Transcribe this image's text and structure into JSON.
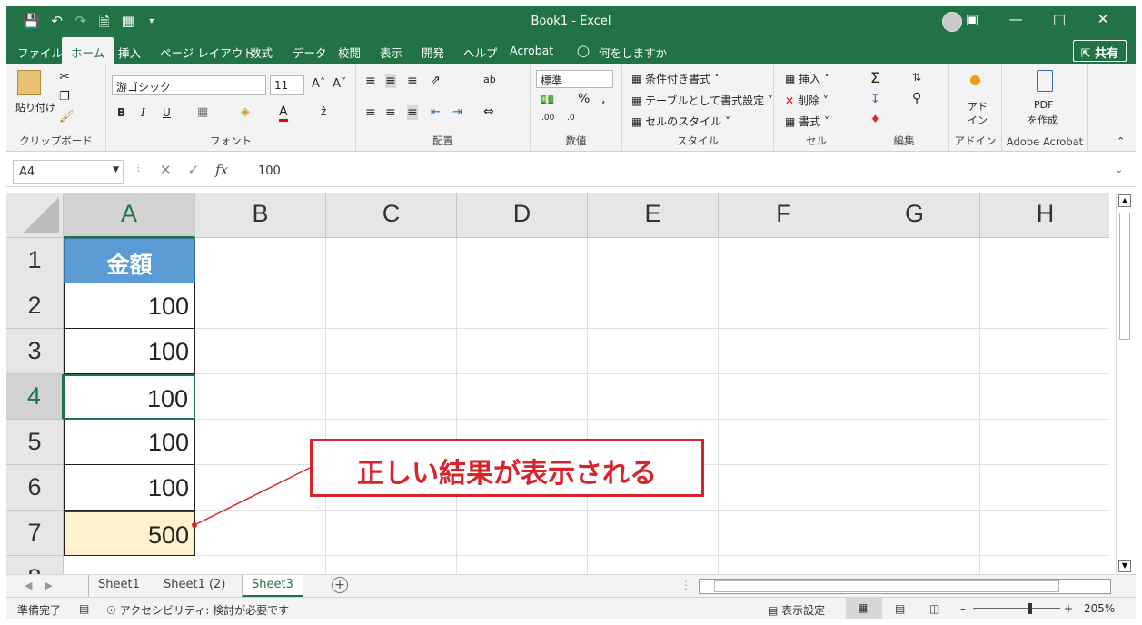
{
  "window": {
    "title": "Book1 - Excel",
    "qat_icons": [
      "save-icon",
      "undo-icon",
      "redo-icon",
      "new-file-icon",
      "form-icon",
      "customize-icon"
    ],
    "controls": [
      "ribbon-display-icon",
      "minimize-icon",
      "maximize-icon",
      "close-icon"
    ]
  },
  "menu": {
    "tabs": [
      "ファイル",
      "ホーム",
      "挿入",
      "ページ レイアウト",
      "数式",
      "データ",
      "校閲",
      "表示",
      "開発",
      "ヘルプ",
      "Acrobat"
    ],
    "active_tab": "ホーム",
    "search_label": "何をしますか",
    "share_label": "共有"
  },
  "ribbon": {
    "clipboard": {
      "paste_label": "貼り付け",
      "group_label": "クリップボード"
    },
    "font": {
      "font_name": "游ゴシック",
      "font_size": "11",
      "group_label": "フォント",
      "bold": "B",
      "italic": "I",
      "underline": "U"
    },
    "alignment": {
      "group_label": "配置"
    },
    "number": {
      "format": "標準",
      "percent": "%",
      "comma": ",",
      "group_label": "数値"
    },
    "styles": {
      "conditional": "条件付き書式",
      "table": "テーブルとして書式設定",
      "cell_styles": "セルのスタイル",
      "group_label": "スタイル"
    },
    "cells": {
      "insert": "挿入",
      "delete": "削除",
      "format": "書式",
      "group_label": "セル"
    },
    "editing": {
      "sum": "Σ",
      "group_label": "編集"
    },
    "addins": {
      "label_line1": "アド",
      "label_line2": "イン",
      "group_label": "アドイン"
    },
    "acrobat": {
      "label_line1": "PDF",
      "label_line2": "を作成",
      "group_label": "Adobe Acrobat"
    }
  },
  "formula_bar": {
    "name_box": "A4",
    "formula": "100",
    "fx": "fx"
  },
  "grid": {
    "columns": [
      "A",
      "B",
      "C",
      "D",
      "E",
      "F",
      "G",
      "H"
    ],
    "rows": [
      "1",
      "2",
      "3",
      "4",
      "5",
      "6",
      "7",
      "8"
    ],
    "selected_column": "A",
    "selected_row": "4",
    "cells": {
      "A1": "金額",
      "A2": "100",
      "A3": "100",
      "A4": "100",
      "A5": "100",
      "A6": "100",
      "A7": "500"
    }
  },
  "sheets": {
    "tabs": [
      "Sheet1",
      "Sheet1 (2)",
      "Sheet3"
    ],
    "active": "Sheet3"
  },
  "status": {
    "ready": "準備完了",
    "accessibility": "アクセシビリティ: 検討が必要です",
    "display_settings": "表示設定",
    "zoom": "205%"
  },
  "annotation": {
    "callout_text": "正しい結果が表示される",
    "color": "#d9222a"
  },
  "colors": {
    "excel_green": "#217346",
    "header_fill": "#5b9bd5",
    "total_fill": "#fff2cc"
  }
}
